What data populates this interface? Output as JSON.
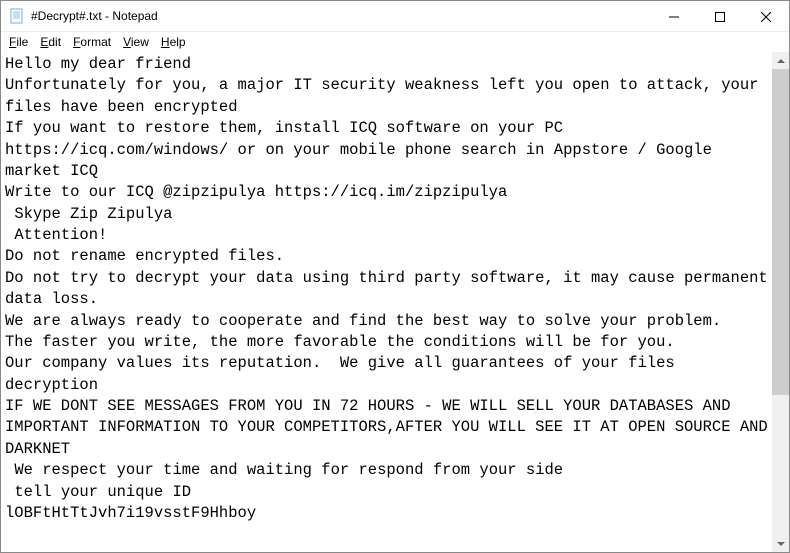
{
  "titlebar": {
    "title": "#Decrypt#.txt - Notepad"
  },
  "menubar": {
    "file": "File",
    "edit": "Edit",
    "format": "Format",
    "view": "View",
    "help": "Help"
  },
  "content": {
    "text": "Hello my dear friend\nUnfortunately for you, a major IT security weakness left you open to attack, your files have been encrypted\nIf you want to restore them, install ICQ software on your PC https://icq.com/windows/ or on your mobile phone search in Appstore / Google market ICQ\nWrite to our ICQ @zipzipulya https://icq.im/zipzipulya\n Skype Zip Zipulya\n Attention!\nDo not rename encrypted files.\nDo not try to decrypt your data using third party software, it may cause permanent data loss.\nWe are always ready to cooperate and find the best way to solve your problem.\nThe faster you write, the more favorable the conditions will be for you.\nOur company values its reputation.  We give all guarantees of your files decryption\nIF WE DONT SEE MESSAGES FROM YOU IN 72 HOURS - WE WILL SELL YOUR DATABASES AND IMPORTANT INFORMATION TO YOUR COMPETITORS,AFTER YOU WILL SEE IT AT OPEN SOURCE AND DARKNET\n We respect your time and waiting for respond from your side\n tell your unique ID\nlOBFtHtTtJvh7i19vsstF9Hhboy"
  }
}
